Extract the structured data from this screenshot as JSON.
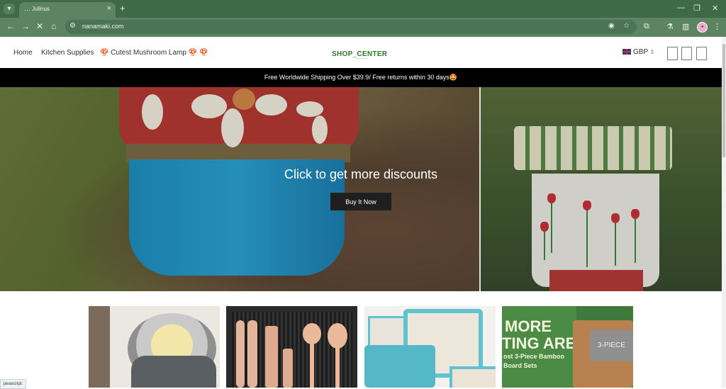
{
  "browser": {
    "tab_title": "Julinus",
    "new_tab_label": "+",
    "url": "nanamaki.com",
    "status_text": "javascript:"
  },
  "header": {
    "nav": [
      "Home",
      "Kitchen Supplies",
      "🍄 Cutest Mushroom Lamp 🍄 🍄"
    ],
    "logo_text": "SHOP_CENTER",
    "logo_sub": "________",
    "currency": "GBP"
  },
  "announcement": "Free Worldwide Shipping Over $39.9/ Free returns within 30 days🤩",
  "hero": {
    "title": "Click to get more discounts",
    "button": "Buy It Now"
  },
  "products": {
    "cutting_board_text": [
      "MORE",
      "TING AREA",
      "ost 3-Piece Bamboo",
      "Board Sets",
      "3-PIECE"
    ]
  },
  "icons": {
    "tab_search": "chevron-down-icon",
    "back": "arrow-left-icon",
    "forward": "arrow-right-icon",
    "stop": "close-icon",
    "home": "home-icon"
  },
  "colors": {
    "chrome_dark": "#3f6a4a",
    "chrome_mid": "#5c8463",
    "announcement_bg": "#000000",
    "logo_green": "#2c7a2c",
    "button_bg": "#1f1f1f"
  }
}
